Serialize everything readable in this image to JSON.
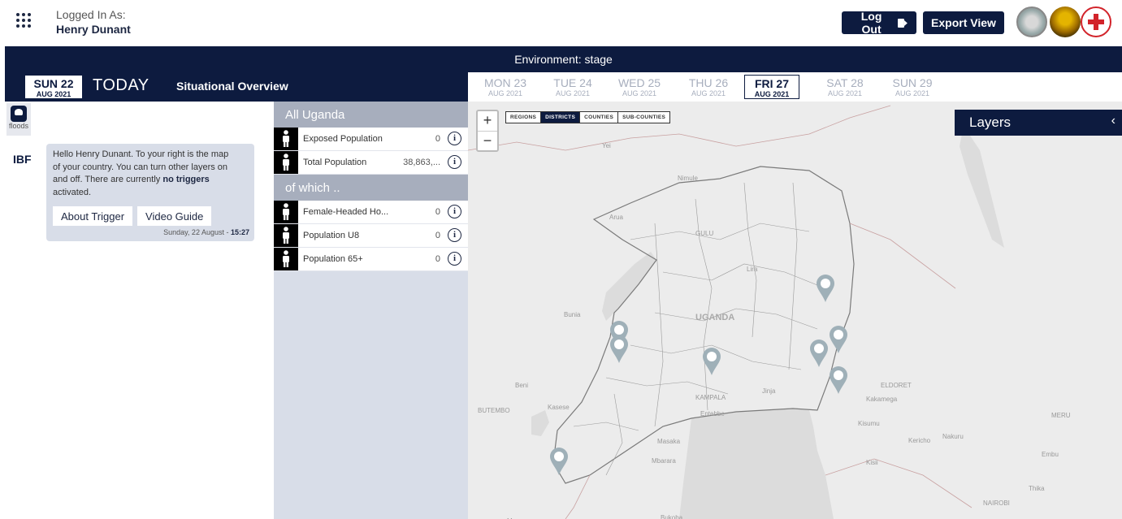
{
  "header": {
    "logged_in_label": "Logged In As:",
    "user_name": "Henry Dunant",
    "logout_label": "Log Out",
    "export_label": "Export View"
  },
  "environment_label": "Environment: stage",
  "datebar": {
    "today_day": "SUN 22",
    "today_month": "AUG 2021",
    "today_label": "TODAY",
    "overview_label": "Situational Overview",
    "timeline": [
      {
        "day": "MON 23",
        "month": "AUG 2021"
      },
      {
        "day": "TUE 24",
        "month": "AUG 2021"
      },
      {
        "day": "WED 25",
        "month": "AUG 2021"
      },
      {
        "day": "THU 26",
        "month": "AUG 2021"
      },
      {
        "day": "FRI 27",
        "month": "AUG 2021"
      },
      {
        "day": "SAT 28",
        "month": "AUG 2021"
      },
      {
        "day": "SUN 29",
        "month": "AUG 2021"
      }
    ],
    "active_index": 4
  },
  "left": {
    "disaster_label": "floods",
    "ibf_label": "IBF",
    "chat_text_1": "Hello Henry Dunant. To your right is the map of your country. You can turn other layers on and off. There are currently ",
    "chat_text_bold": "no triggers",
    "chat_text_2": " activated.",
    "about_trigger_label": "About Trigger",
    "video_guide_label": "Video Guide",
    "chat_date": "Sunday, 22 August - ",
    "chat_time": "15:27"
  },
  "aggregates": {
    "header": "All Uganda",
    "sub_header": "of which ..",
    "main_rows": [
      {
        "label": "Exposed Population",
        "value": "0",
        "icon": "exposed-population-icon"
      },
      {
        "label": "Total Population",
        "value": "38,863,...",
        "icon": "total-population-icon"
      }
    ],
    "sub_rows": [
      {
        "label": "Female-Headed Ho...",
        "value": "0",
        "icon": "female-headed-household-icon"
      },
      {
        "label": "Population U8",
        "value": "0",
        "icon": "population-u8-icon"
      },
      {
        "label": "Population 65+",
        "value": "0",
        "icon": "population-65-icon"
      }
    ]
  },
  "map": {
    "zoom_in": "+",
    "zoom_out": "−",
    "admin_levels": [
      "REGIONS",
      "DISTRICTS",
      "COUNTIES",
      "SUB-COUNTIES"
    ],
    "active_admin_level": "DISTRICTS",
    "layers_title": "Layers",
    "layers_chevron": "‹",
    "place_labels": [
      "Yei",
      "Nimule",
      "Arua",
      "GULU",
      "Lira",
      "Bunia",
      "UGANDA",
      "Beni",
      "Kasese",
      "BUTEMBO",
      "KAMPALA",
      "Entebbe",
      "Jinja",
      "ELDORET",
      "Kakamega",
      "Kisumu",
      "Kericho",
      "Nakuru",
      "MERU",
      "Masaka",
      "Mbarara",
      "Kisii",
      "Embu",
      "Thika",
      "NAIROBI",
      "Bukoba",
      "Mwanza"
    ]
  },
  "colors": {
    "navy": "#0d1b3f",
    "panel_grey": "#d8dde8",
    "header_grey": "#a7aebd",
    "marker": "#9fb0b8"
  }
}
